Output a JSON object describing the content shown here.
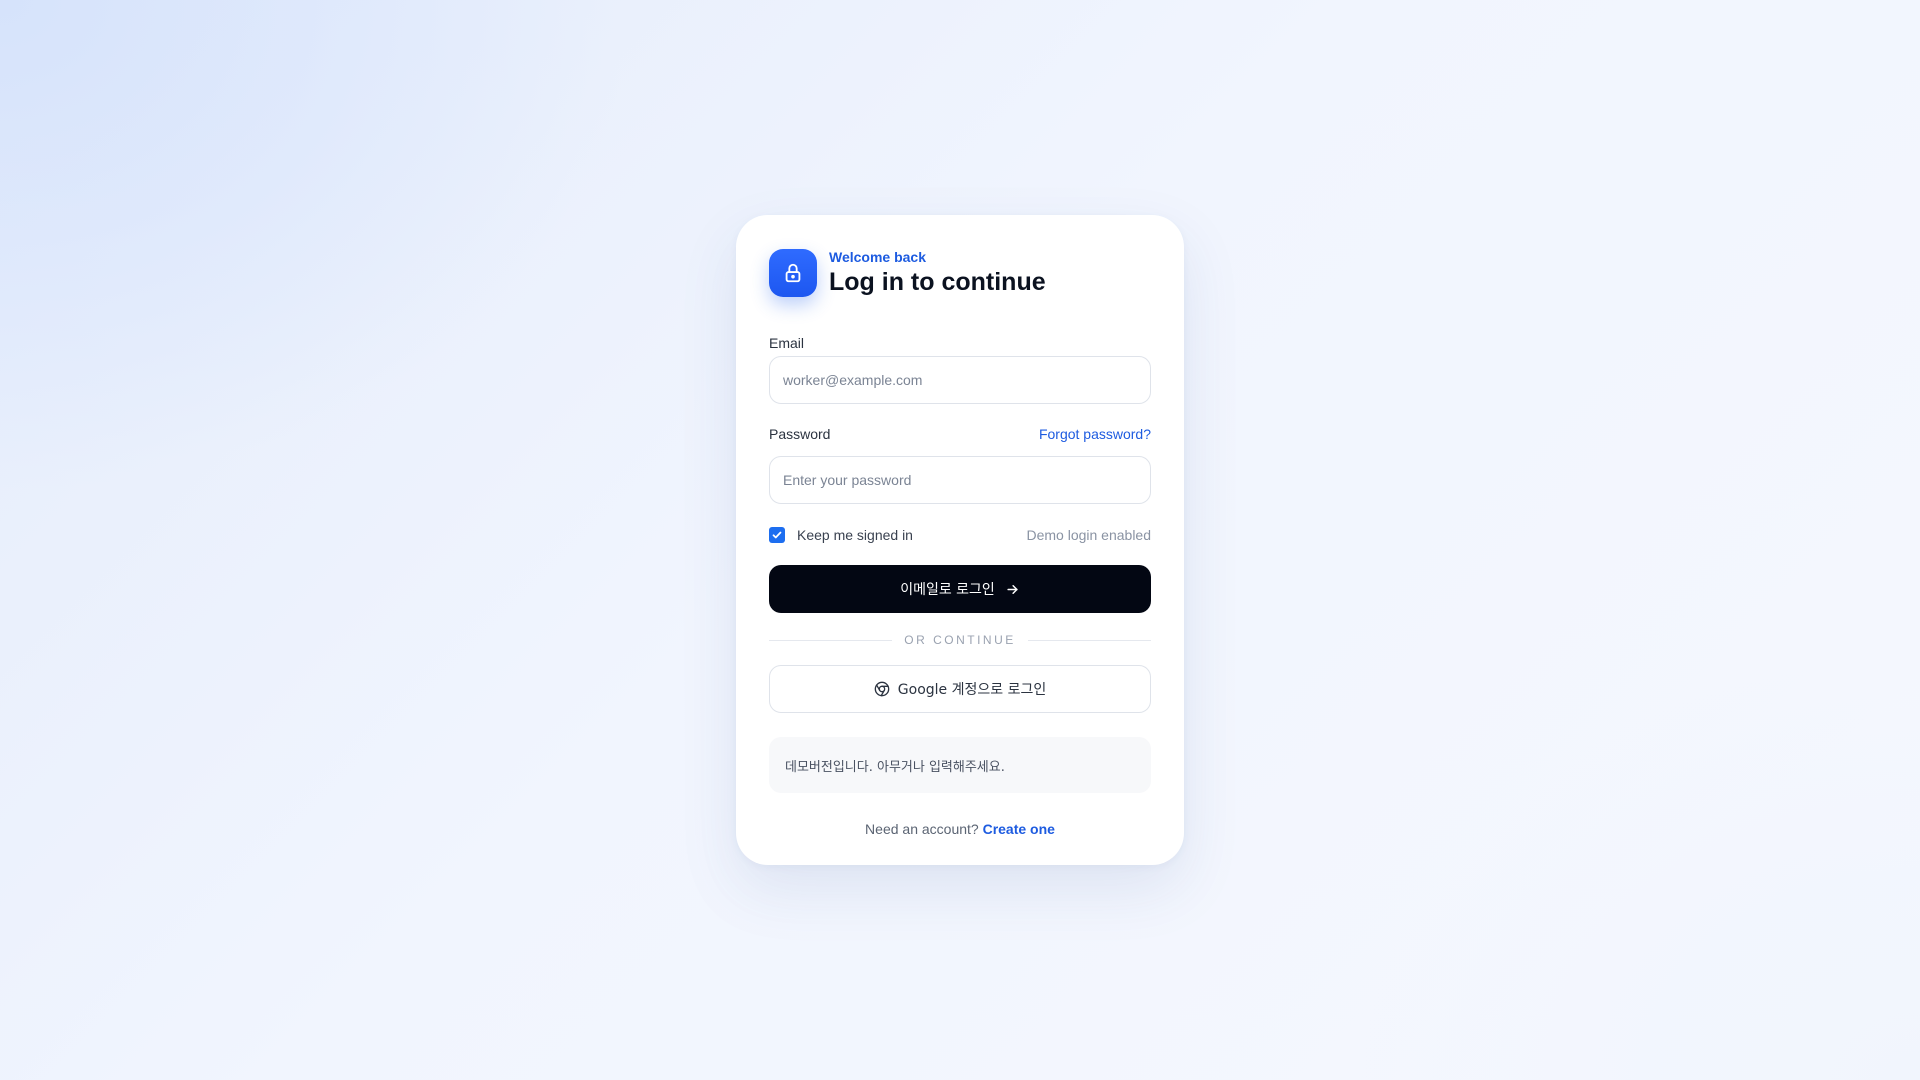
{
  "header": {
    "eyebrow": "Welcome back",
    "title": "Log in to continue",
    "icon": "lock-icon"
  },
  "email": {
    "label": "Email",
    "placeholder": "worker@example.com",
    "value": ""
  },
  "password": {
    "label": "Password",
    "forgot_label": "Forgot password?",
    "placeholder": "Enter your password",
    "value": ""
  },
  "options": {
    "keep_signed_in_label": "Keep me signed in",
    "keep_signed_in_checked": true,
    "demo_note": "Demo login enabled"
  },
  "primary_button": {
    "label": "이메일로 로그인",
    "icon": "arrow-right-icon"
  },
  "divider": {
    "text": "OR CONTINUE"
  },
  "google_button": {
    "label": "Google 계정으로 로그인",
    "icon": "chrome-icon"
  },
  "notice": {
    "text": "데모버전입니다. 아무거나 입력해주세요."
  },
  "footer": {
    "prompt": "Need an account?",
    "link_label": "Create one"
  },
  "colors": {
    "accent": "#1d5be0",
    "primary_button_bg": "#030713",
    "logo_bg": "#2563eb"
  }
}
